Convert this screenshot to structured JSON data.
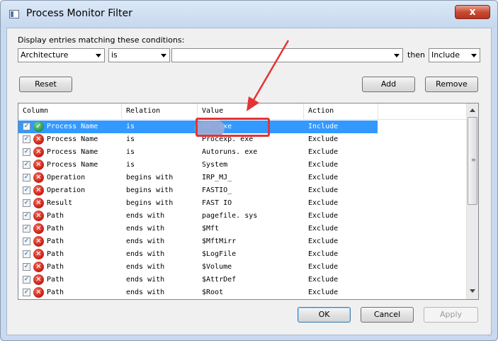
{
  "window": {
    "title": "Process Monitor Filter",
    "close_label": "x"
  },
  "filter": {
    "conditions_label": "Display entries matching these conditions:",
    "column_value": "Architecture",
    "relation_value": "is",
    "value_value": "",
    "then_label": "then",
    "action_value": "Include"
  },
  "buttons": {
    "reset": "Reset",
    "add": "Add",
    "remove": "Remove",
    "ok": "OK",
    "cancel": "Cancel",
    "apply": "Apply"
  },
  "list": {
    "headers": {
      "column": "Column",
      "relation": "Relation",
      "value": "Value",
      "action": "Action"
    },
    "rows": [
      {
        "column": "Process Name",
        "relation": "is",
        "value": "nd. exe",
        "action": "Include",
        "status": "include",
        "checked": true,
        "selected": true
      },
      {
        "column": "Process Name",
        "relation": "is",
        "value": "Procexp. exe",
        "action": "Exclude",
        "status": "exclude",
        "checked": true
      },
      {
        "column": "Process Name",
        "relation": "is",
        "value": "Autoruns. exe",
        "action": "Exclude",
        "status": "exclude",
        "checked": true
      },
      {
        "column": "Process Name",
        "relation": "is",
        "value": "System",
        "action": "Exclude",
        "status": "exclude",
        "checked": true
      },
      {
        "column": "Operation",
        "relation": "begins with",
        "value": "IRP_MJ_",
        "action": "Exclude",
        "status": "exclude",
        "checked": true
      },
      {
        "column": "Operation",
        "relation": "begins with",
        "value": "FASTIO_",
        "action": "Exclude",
        "status": "exclude",
        "checked": true
      },
      {
        "column": "Result",
        "relation": "begins with",
        "value": "FAST IO",
        "action": "Exclude",
        "status": "exclude",
        "checked": true
      },
      {
        "column": "Path",
        "relation": "ends with",
        "value": "pagefile. sys",
        "action": "Exclude",
        "status": "exclude",
        "checked": true
      },
      {
        "column": "Path",
        "relation": "ends with",
        "value": "$Mft",
        "action": "Exclude",
        "status": "exclude",
        "checked": true
      },
      {
        "column": "Path",
        "relation": "ends with",
        "value": "$MftMirr",
        "action": "Exclude",
        "status": "exclude",
        "checked": true
      },
      {
        "column": "Path",
        "relation": "ends with",
        "value": "$LogFile",
        "action": "Exclude",
        "status": "exclude",
        "checked": true
      },
      {
        "column": "Path",
        "relation": "ends with",
        "value": "$Volume",
        "action": "Exclude",
        "status": "exclude",
        "checked": true
      },
      {
        "column": "Path",
        "relation": "ends with",
        "value": "$AttrDef",
        "action": "Exclude",
        "status": "exclude",
        "checked": true
      },
      {
        "column": "Path",
        "relation": "ends with",
        "value": "$Root",
        "action": "Exclude",
        "status": "exclude",
        "checked": true
      }
    ]
  },
  "colors": {
    "selection": "#3399ff",
    "annotation": "#e53333",
    "exclude_icon": "#c41a10",
    "include_icon": "#1f8f50"
  },
  "icons": {
    "exclude": "red-x-circle-icon",
    "include": "green-check-circle-icon"
  }
}
